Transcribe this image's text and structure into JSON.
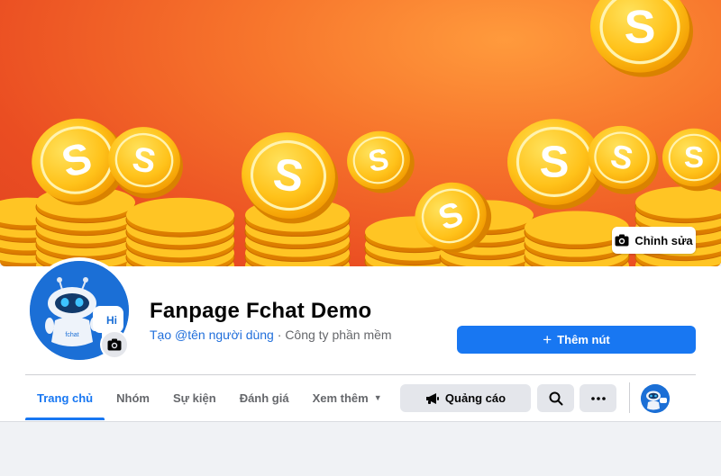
{
  "cover": {
    "edit_label": "Chỉnh sửa"
  },
  "avatar": {
    "hi_text": "Hi",
    "brand_text": "fchat"
  },
  "page": {
    "name": "Fanpage Fchat Demo",
    "username_link": "Tạo @tên người dùng",
    "separator": " · ",
    "category": "Công ty phần mềm"
  },
  "actions": {
    "add_button_label": "Thêm nút",
    "ads_label": "Quảng cáo"
  },
  "tabs": [
    {
      "label": "Trang chủ",
      "active": true
    },
    {
      "label": "Nhóm"
    },
    {
      "label": "Sự kiện"
    },
    {
      "label": "Đánh giá"
    },
    {
      "label": "Xem thêm"
    }
  ],
  "coin_letter": "S",
  "colors": {
    "primary": "#1877f2",
    "cover_orange": "#ea4d22",
    "coin_gold": "#f7b500"
  }
}
